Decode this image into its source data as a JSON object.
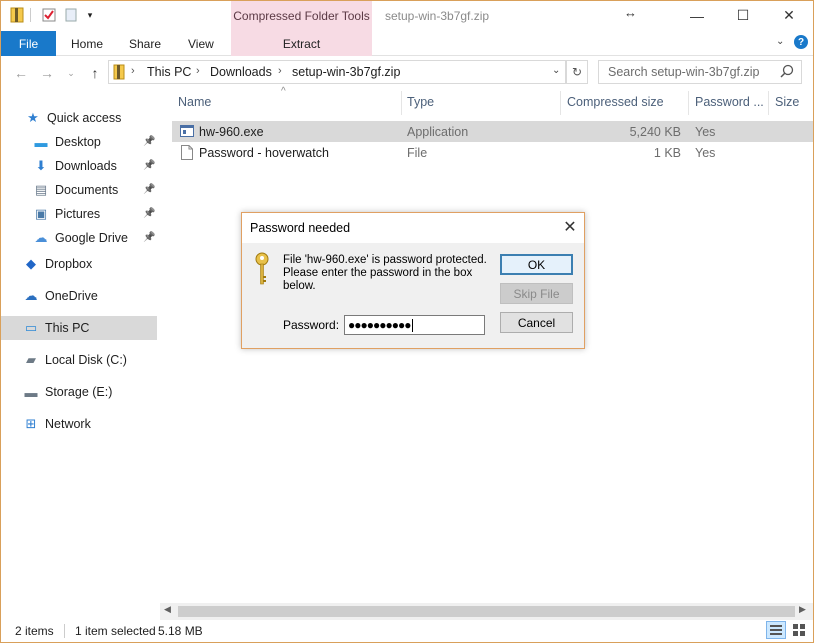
{
  "window": {
    "title": "setup-win-3b7gf.zip",
    "context_tab_group": "Compressed Folder Tools",
    "controls": {
      "minimize": "—",
      "maximize": "☐",
      "close": "✕"
    }
  },
  "ribbon": {
    "file_tab": "File",
    "tabs": [
      "Home",
      "Share",
      "View"
    ],
    "context_tab": "Extract"
  },
  "address_bar": {
    "segments": [
      "This PC",
      "Downloads",
      "setup-win-3b7gf.zip"
    ]
  },
  "search": {
    "placeholder": "Search setup-win-3b7gf.zip"
  },
  "nav_pane": {
    "items": [
      {
        "label": "Quick access",
        "icon": "star-icon"
      },
      {
        "label": "Desktop",
        "icon": "desktop-icon",
        "pinned": true
      },
      {
        "label": "Downloads",
        "icon": "download-arrow-icon",
        "pinned": true
      },
      {
        "label": "Documents",
        "icon": "document-icon",
        "pinned": true
      },
      {
        "label": "Pictures",
        "icon": "pictures-icon",
        "pinned": true
      },
      {
        "label": "Google Drive",
        "icon": "cloud-icon",
        "pinned": true
      },
      {
        "label": "Dropbox",
        "icon": "dropbox-icon"
      },
      {
        "label": "OneDrive",
        "icon": "onedrive-icon"
      },
      {
        "label": "This PC",
        "icon": "computer-icon",
        "selected": true
      },
      {
        "label": "Local Disk (C:)",
        "icon": "disk-icon"
      },
      {
        "label": "Storage (E:)",
        "icon": "drive-icon"
      },
      {
        "label": "Network",
        "icon": "network-icon"
      }
    ]
  },
  "file_list": {
    "columns": [
      "Name",
      "Type",
      "Compressed size",
      "Password ...",
      "Size"
    ],
    "rows": [
      {
        "name": "hw-960.exe",
        "type": "Application",
        "compressed_size": "5,240 KB",
        "password": "Yes",
        "selected": true
      },
      {
        "name": "Password - hoverwatch",
        "type": "File",
        "compressed_size": "1 KB",
        "password": "Yes"
      }
    ]
  },
  "status_bar": {
    "item_count": "2 items",
    "selection": "1 item selected",
    "selection_size": "5.18 MB"
  },
  "dialog": {
    "title": "Password needed",
    "message": "File 'hw-960.exe' is password protected. Please enter the password in the box below.",
    "ok_label": "OK",
    "skip_label": "Skip File",
    "cancel_label": "Cancel",
    "password_label": "Password:",
    "password_value": "●●●●●●●●●●"
  },
  "colors": {
    "accent": "#1979ca",
    "context_tab": "#f7dbe4",
    "selection": "#d9d9d9",
    "dialog_border": "#e0a062"
  }
}
